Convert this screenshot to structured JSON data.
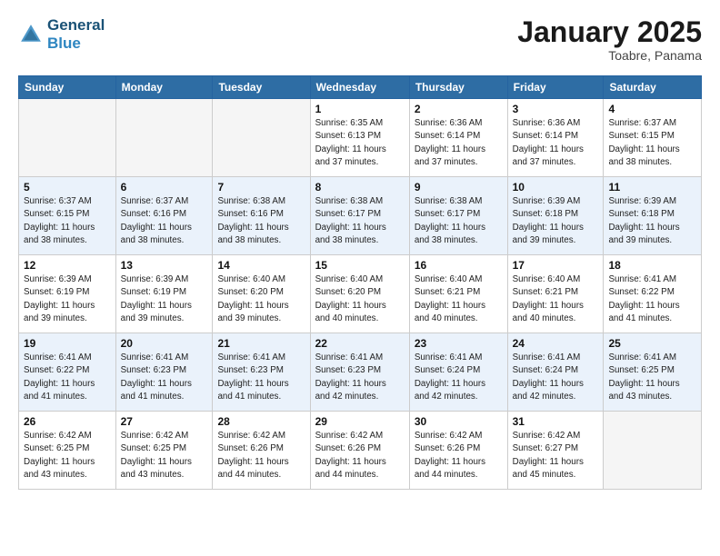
{
  "header": {
    "logo_line1": "General",
    "logo_line2": "Blue",
    "month": "January 2025",
    "location": "Toabre, Panama"
  },
  "weekdays": [
    "Sunday",
    "Monday",
    "Tuesday",
    "Wednesday",
    "Thursday",
    "Friday",
    "Saturday"
  ],
  "weeks": [
    [
      {
        "day": "",
        "info": ""
      },
      {
        "day": "",
        "info": ""
      },
      {
        "day": "",
        "info": ""
      },
      {
        "day": "1",
        "info": "Sunrise: 6:35 AM\nSunset: 6:13 PM\nDaylight: 11 hours\nand 37 minutes."
      },
      {
        "day": "2",
        "info": "Sunrise: 6:36 AM\nSunset: 6:14 PM\nDaylight: 11 hours\nand 37 minutes."
      },
      {
        "day": "3",
        "info": "Sunrise: 6:36 AM\nSunset: 6:14 PM\nDaylight: 11 hours\nand 37 minutes."
      },
      {
        "day": "4",
        "info": "Sunrise: 6:37 AM\nSunset: 6:15 PM\nDaylight: 11 hours\nand 38 minutes."
      }
    ],
    [
      {
        "day": "5",
        "info": "Sunrise: 6:37 AM\nSunset: 6:15 PM\nDaylight: 11 hours\nand 38 minutes."
      },
      {
        "day": "6",
        "info": "Sunrise: 6:37 AM\nSunset: 6:16 PM\nDaylight: 11 hours\nand 38 minutes."
      },
      {
        "day": "7",
        "info": "Sunrise: 6:38 AM\nSunset: 6:16 PM\nDaylight: 11 hours\nand 38 minutes."
      },
      {
        "day": "8",
        "info": "Sunrise: 6:38 AM\nSunset: 6:17 PM\nDaylight: 11 hours\nand 38 minutes."
      },
      {
        "day": "9",
        "info": "Sunrise: 6:38 AM\nSunset: 6:17 PM\nDaylight: 11 hours\nand 38 minutes."
      },
      {
        "day": "10",
        "info": "Sunrise: 6:39 AM\nSunset: 6:18 PM\nDaylight: 11 hours\nand 39 minutes."
      },
      {
        "day": "11",
        "info": "Sunrise: 6:39 AM\nSunset: 6:18 PM\nDaylight: 11 hours\nand 39 minutes."
      }
    ],
    [
      {
        "day": "12",
        "info": "Sunrise: 6:39 AM\nSunset: 6:19 PM\nDaylight: 11 hours\nand 39 minutes."
      },
      {
        "day": "13",
        "info": "Sunrise: 6:39 AM\nSunset: 6:19 PM\nDaylight: 11 hours\nand 39 minutes."
      },
      {
        "day": "14",
        "info": "Sunrise: 6:40 AM\nSunset: 6:20 PM\nDaylight: 11 hours\nand 39 minutes."
      },
      {
        "day": "15",
        "info": "Sunrise: 6:40 AM\nSunset: 6:20 PM\nDaylight: 11 hours\nand 40 minutes."
      },
      {
        "day": "16",
        "info": "Sunrise: 6:40 AM\nSunset: 6:21 PM\nDaylight: 11 hours\nand 40 minutes."
      },
      {
        "day": "17",
        "info": "Sunrise: 6:40 AM\nSunset: 6:21 PM\nDaylight: 11 hours\nand 40 minutes."
      },
      {
        "day": "18",
        "info": "Sunrise: 6:41 AM\nSunset: 6:22 PM\nDaylight: 11 hours\nand 41 minutes."
      }
    ],
    [
      {
        "day": "19",
        "info": "Sunrise: 6:41 AM\nSunset: 6:22 PM\nDaylight: 11 hours\nand 41 minutes."
      },
      {
        "day": "20",
        "info": "Sunrise: 6:41 AM\nSunset: 6:23 PM\nDaylight: 11 hours\nand 41 minutes."
      },
      {
        "day": "21",
        "info": "Sunrise: 6:41 AM\nSunset: 6:23 PM\nDaylight: 11 hours\nand 41 minutes."
      },
      {
        "day": "22",
        "info": "Sunrise: 6:41 AM\nSunset: 6:23 PM\nDaylight: 11 hours\nand 42 minutes."
      },
      {
        "day": "23",
        "info": "Sunrise: 6:41 AM\nSunset: 6:24 PM\nDaylight: 11 hours\nand 42 minutes."
      },
      {
        "day": "24",
        "info": "Sunrise: 6:41 AM\nSunset: 6:24 PM\nDaylight: 11 hours\nand 42 minutes."
      },
      {
        "day": "25",
        "info": "Sunrise: 6:41 AM\nSunset: 6:25 PM\nDaylight: 11 hours\nand 43 minutes."
      }
    ],
    [
      {
        "day": "26",
        "info": "Sunrise: 6:42 AM\nSunset: 6:25 PM\nDaylight: 11 hours\nand 43 minutes."
      },
      {
        "day": "27",
        "info": "Sunrise: 6:42 AM\nSunset: 6:25 PM\nDaylight: 11 hours\nand 43 minutes."
      },
      {
        "day": "28",
        "info": "Sunrise: 6:42 AM\nSunset: 6:26 PM\nDaylight: 11 hours\nand 44 minutes."
      },
      {
        "day": "29",
        "info": "Sunrise: 6:42 AM\nSunset: 6:26 PM\nDaylight: 11 hours\nand 44 minutes."
      },
      {
        "day": "30",
        "info": "Sunrise: 6:42 AM\nSunset: 6:26 PM\nDaylight: 11 hours\nand 44 minutes."
      },
      {
        "day": "31",
        "info": "Sunrise: 6:42 AM\nSunset: 6:27 PM\nDaylight: 11 hours\nand 45 minutes."
      },
      {
        "day": "",
        "info": ""
      }
    ]
  ]
}
